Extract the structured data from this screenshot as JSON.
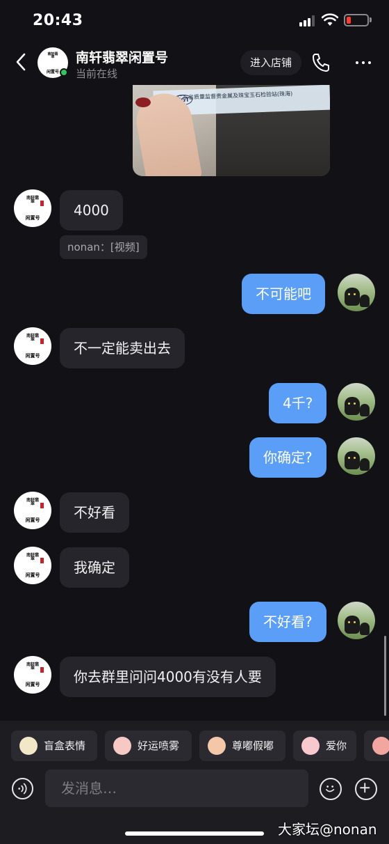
{
  "status_bar": {
    "time": "20:43"
  },
  "header": {
    "shop_name": "南轩翡翠闲置号",
    "online_status": "当前在线",
    "enter_shop_label": "进入店铺"
  },
  "photo": {
    "card_text": "广东省质量监督贵金属及珠宝玉石检验站(珠海)",
    "card_logo": "GGT"
  },
  "avatar_mark": {
    "top": "南轩翡翠",
    "bottom": "闲置号"
  },
  "messages": [
    {
      "side": "in",
      "text": "4000"
    },
    {
      "side": "in",
      "quote": "nonan：[视频]"
    },
    {
      "side": "out",
      "text": "不可能吧"
    },
    {
      "side": "in",
      "text": "不一定能卖出去"
    },
    {
      "side": "out",
      "text": "4千?"
    },
    {
      "side": "out",
      "text": "你确定?"
    },
    {
      "side": "in",
      "text": "不好看"
    },
    {
      "side": "in",
      "text": "我确定"
    },
    {
      "side": "out",
      "text": "不好看?"
    },
    {
      "side": "in",
      "text": "你去群里问问4000有没有人要"
    }
  ],
  "emoji_bar": [
    {
      "label": "盲盒表情",
      "icon": "blind-box-icon",
      "color": "#f2e7c6"
    },
    {
      "label": "好运喷雾",
      "icon": "lucky-spray-icon",
      "color": "#f6c9c4"
    },
    {
      "label": "尊嘟假嘟",
      "icon": "really-icon",
      "color": "#f4c7a8"
    },
    {
      "label": "爱你",
      "icon": "love-you-icon",
      "color": "#f7c9cf"
    }
  ],
  "input": {
    "placeholder": "发消息…"
  },
  "watermark": "大家坛@nonan",
  "colors": {
    "outgoing_bubble": "#5b9ef7",
    "incoming_bubble": "#25252b",
    "background": "#121216",
    "online": "#30c85a"
  }
}
